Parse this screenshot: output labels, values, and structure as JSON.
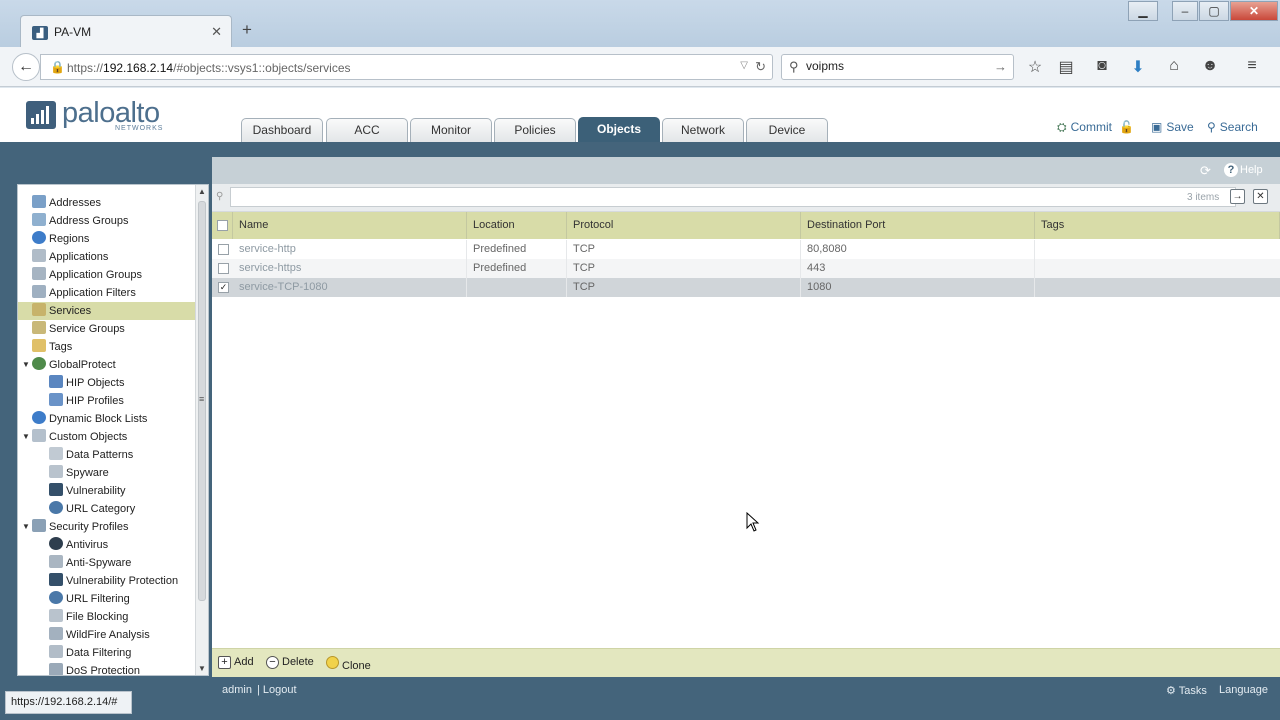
{
  "browser": {
    "tab_title": "PA-VM",
    "tab_favicon": "palo-alto-favicon",
    "new_tab_label": "+",
    "url_host": "192.168.2.14",
    "url_prefix": "https://",
    "url_path": "/#objects::vsys1::objects/services",
    "search_value": "voipms",
    "status_url": "https://192.168.2.14/#"
  },
  "header": {
    "logo_word": "paloalto",
    "logo_sub": "NETWORKS",
    "tabs": [
      {
        "label": "Dashboard"
      },
      {
        "label": "ACC"
      },
      {
        "label": "Monitor"
      },
      {
        "label": "Policies"
      },
      {
        "label": "Objects"
      },
      {
        "label": "Network"
      },
      {
        "label": "Device"
      }
    ],
    "active_tab": "Objects",
    "commit_label": "Commit",
    "save_label": "Save",
    "search_label": "Search"
  },
  "sidebar": {
    "items": [
      {
        "label": "Addresses",
        "icon": "address-icon"
      },
      {
        "label": "Address Groups",
        "icon": "address-group-icon"
      },
      {
        "label": "Regions",
        "icon": "globe-icon"
      },
      {
        "label": "Applications",
        "icon": "application-icon"
      },
      {
        "label": "Application Groups",
        "icon": "application-group-icon"
      },
      {
        "label": "Application Filters",
        "icon": "filter-icon"
      },
      {
        "label": "Services",
        "icon": "service-icon"
      },
      {
        "label": "Service Groups",
        "icon": "service-group-icon"
      },
      {
        "label": "Tags",
        "icon": "tag-icon"
      },
      {
        "label": "GlobalProtect",
        "icon": "globalprotect-icon"
      },
      {
        "label": "HIP Objects",
        "icon": "hip-object-icon"
      },
      {
        "label": "HIP Profiles",
        "icon": "hip-profile-icon"
      },
      {
        "label": "Dynamic Block Lists",
        "icon": "block-list-icon"
      },
      {
        "label": "Custom Objects",
        "icon": "custom-object-icon"
      },
      {
        "label": "Data Patterns",
        "icon": "data-pattern-icon"
      },
      {
        "label": "Spyware",
        "icon": "spyware-icon"
      },
      {
        "label": "Vulnerability",
        "icon": "vulnerability-icon"
      },
      {
        "label": "URL Category",
        "icon": "url-category-icon"
      },
      {
        "label": "Security Profiles",
        "icon": "security-profile-icon"
      },
      {
        "label": "Antivirus",
        "icon": "antivirus-icon"
      },
      {
        "label": "Anti-Spyware",
        "icon": "anti-spyware-icon"
      },
      {
        "label": "Vulnerability Protection",
        "icon": "vulnerability-protection-icon"
      },
      {
        "label": "URL Filtering",
        "icon": "url-filtering-icon"
      },
      {
        "label": "File Blocking",
        "icon": "file-blocking-icon"
      },
      {
        "label": "WildFire Analysis",
        "icon": "wildfire-icon"
      },
      {
        "label": "Data Filtering",
        "icon": "data-filtering-icon"
      },
      {
        "label": "DoS Protection",
        "icon": "dos-protection-icon"
      }
    ],
    "selected": "Services"
  },
  "main": {
    "help_label": "Help",
    "item_count": "3 items",
    "filter_value": "",
    "columns": [
      "Name",
      "Location",
      "Protocol",
      "Destination Port",
      "Tags"
    ],
    "rows": [
      {
        "name": "service-http",
        "location": "Predefined",
        "protocol": "TCP",
        "port": "80,8080",
        "tags": "",
        "checked": false
      },
      {
        "name": "service-https",
        "location": "Predefined",
        "protocol": "TCP",
        "port": "443",
        "tags": "",
        "checked": false
      },
      {
        "name": "service-TCP-1080",
        "location": "",
        "protocol": "TCP",
        "port": "1080",
        "tags": "",
        "checked": true
      }
    ],
    "footer": {
      "add_label": "Add",
      "delete_label": "Delete",
      "clone_label": "Clone"
    }
  },
  "statusbar": {
    "user": "admin",
    "logout": "| Logout",
    "tasks": "Tasks",
    "language": "Language"
  },
  "colors": {
    "accent_dark": "#44647b",
    "grid_header": "#d8dca8",
    "active_tab": "#3c6078"
  }
}
